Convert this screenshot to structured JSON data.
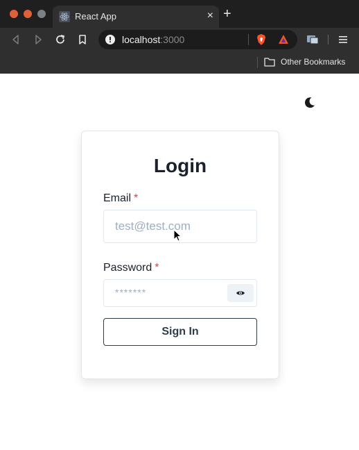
{
  "browser": {
    "tab": {
      "title": "React App",
      "close": "×"
    },
    "new_tab": "+",
    "url": {
      "host": "localhost",
      "port": ":3000"
    },
    "bookmarks_bar": {
      "folder": "Other Bookmarks"
    }
  },
  "login": {
    "title": "Login",
    "email": {
      "label": "Email",
      "required": "*",
      "placeholder": "test@test.com"
    },
    "password": {
      "label": "Password",
      "required": "*",
      "placeholder": "*******"
    },
    "submit_label": "Sign In"
  },
  "colors": {
    "required": "#e53e3e",
    "button_border": "#2d3d4a",
    "placeholder": "#a0aec0"
  }
}
